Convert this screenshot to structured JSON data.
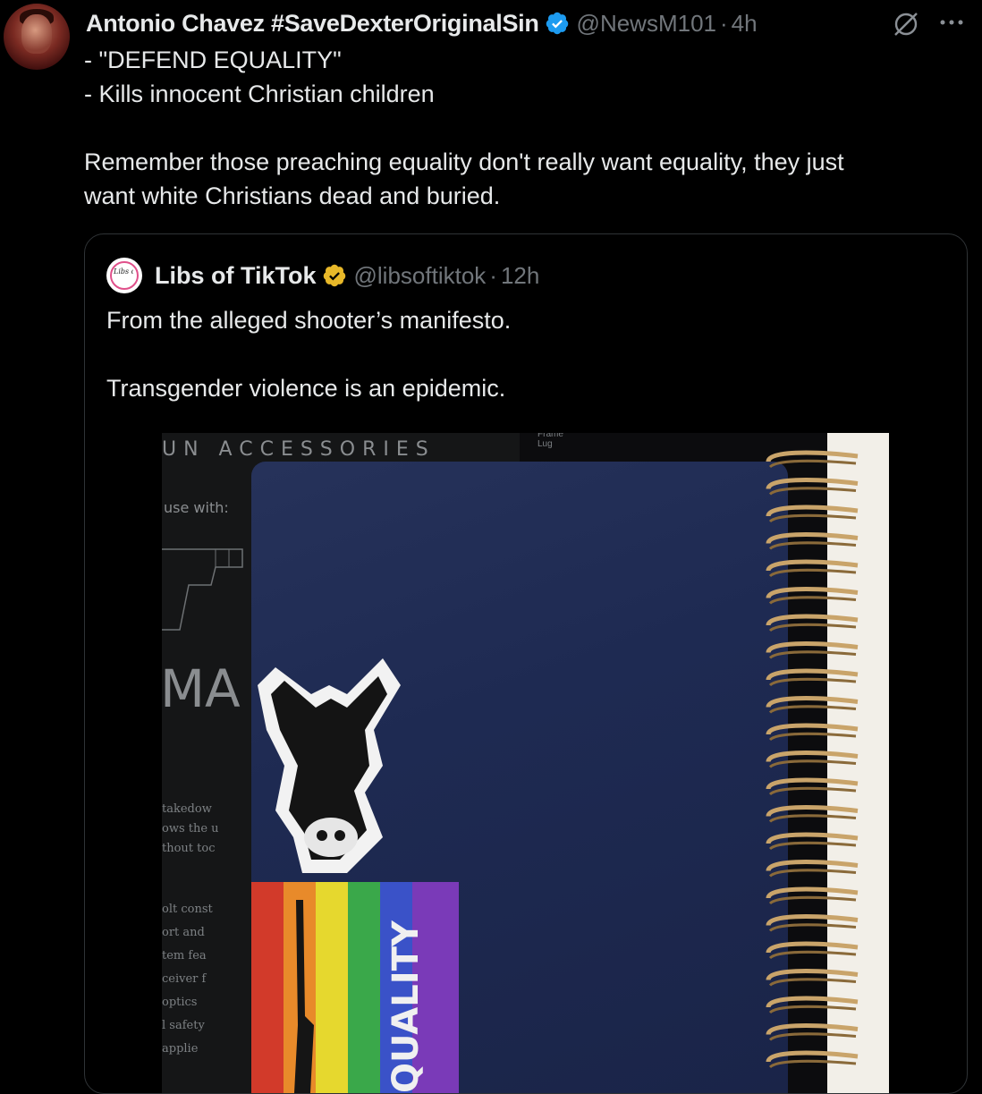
{
  "tweet": {
    "author_name": "Antonio Chavez #SaveDexterOriginalSin",
    "handle": "@NewsM101",
    "separator": "·",
    "time": "4h",
    "lines": [
      "- \"DEFEND EQUALITY\"",
      "- Kills innocent Christian children",
      "Remember those preaching equality don't really want equality, they just",
      "want white Christians dead and buried."
    ]
  },
  "quoted": {
    "avatar_text": "Libs of TikTok",
    "author_name": "Libs of TikTok",
    "handle": "@libsoftiktok",
    "separator": "·",
    "time": "12h",
    "lines": [
      "From the alleged shooter’s manifesto.",
      "Transgender violence is an epidemic."
    ]
  },
  "photo": {
    "manual_title": "UN ACCESSORIES",
    "manual_sub": "use with:",
    "manual_big": "MA",
    "manual_lines_a": [
      "takedow",
      "ows the u",
      "thout toc"
    ],
    "manual_lines_b": [
      "olt const",
      "ort and",
      "tem fea",
      "ceiver f",
      "optics",
      "l safety",
      "applie"
    ],
    "right_text": "Frame Lug",
    "flag_text": "QUALITY"
  },
  "colors": {
    "text": "#e7e9ea",
    "muted": "#71767b",
    "border": "#2f3336",
    "verified_blue": "#1d9bf0",
    "verified_gold": "#e8b829"
  },
  "icons": [
    "verified-badge-icon",
    "grok-icon",
    "more-icon",
    "gold-verified-badge-icon"
  ]
}
